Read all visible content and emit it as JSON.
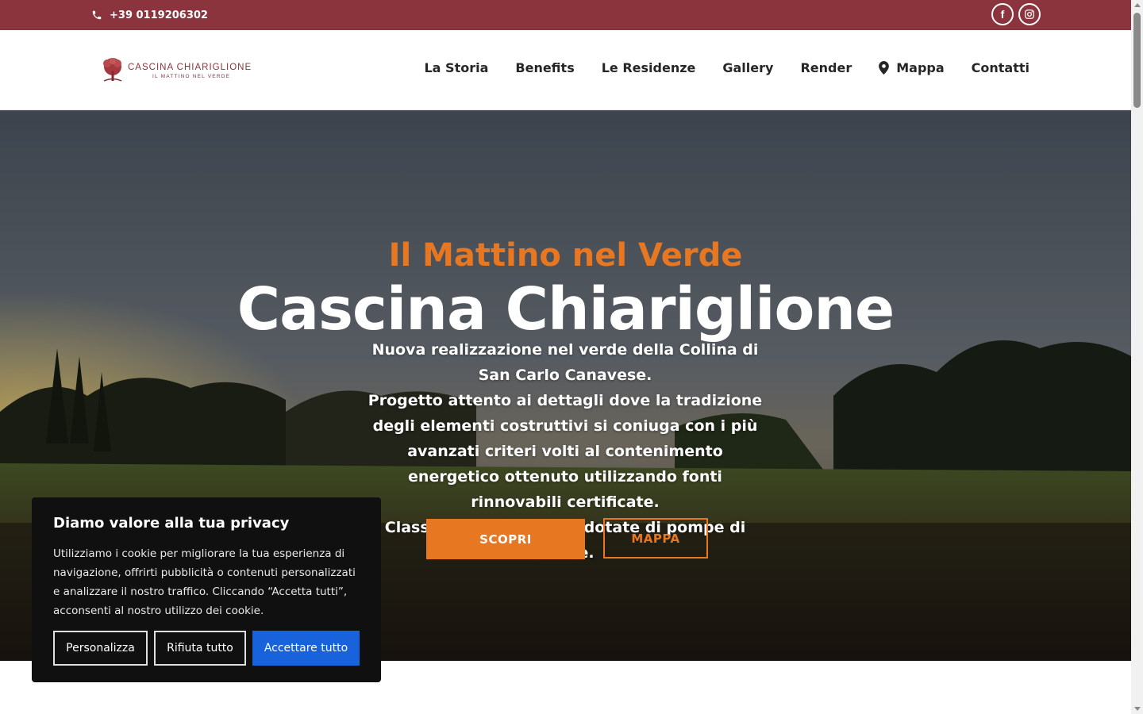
{
  "topbar": {
    "phone": "+39 0119206302"
  },
  "header": {
    "logo_name": "CASCINA CHIARIGLIONE",
    "logo_tagline": "IL MATTINO NEL VERDE",
    "nav": [
      "La Storia",
      "Benefits",
      "Le Residenze",
      "Gallery",
      "Render",
      "Mappa",
      "Contatti"
    ]
  },
  "hero": {
    "subtitle": "Il Mattino nel Verde",
    "title": "Cascina Chiariglione",
    "desc_1": "Nuova realizzazione nel verde della Collina di San Carlo Canavese.",
    "desc_2": "Progetto attento ai dettagli dove la tradizione degli elementi costruttivi si coniuga con i più avanzati criteri volti al contenimento energetico ottenuto utilizzando fonti rinnovabili certificate.",
    "desc_3": "Classe energetica A4 e dotate di pompe di calore.",
    "btn_primary": "SCOPRI",
    "btn_secondary": "MAPPA"
  },
  "cookie": {
    "title": "Diamo valore alla tua privacy",
    "text": "Utilizziamo i cookie per migliorare la tua esperienza di navigazione, offrirti pubblicità o contenuti personalizzati e analizzare il nostro traffico. Cliccando “Accetta tutti”, acconsenti al nostro utilizzo dei cookie.",
    "btn_customize": "Personalizza",
    "btn_reject": "Rifiuta tutto",
    "btn_accept": "Accettare tutto"
  },
  "colors": {
    "brand": "#8b343d",
    "accent": "#e87721",
    "accept": "#1863dc"
  },
  "icons": [
    "phone-icon",
    "facebook-icon",
    "instagram-icon",
    "map-pin-icon"
  ]
}
